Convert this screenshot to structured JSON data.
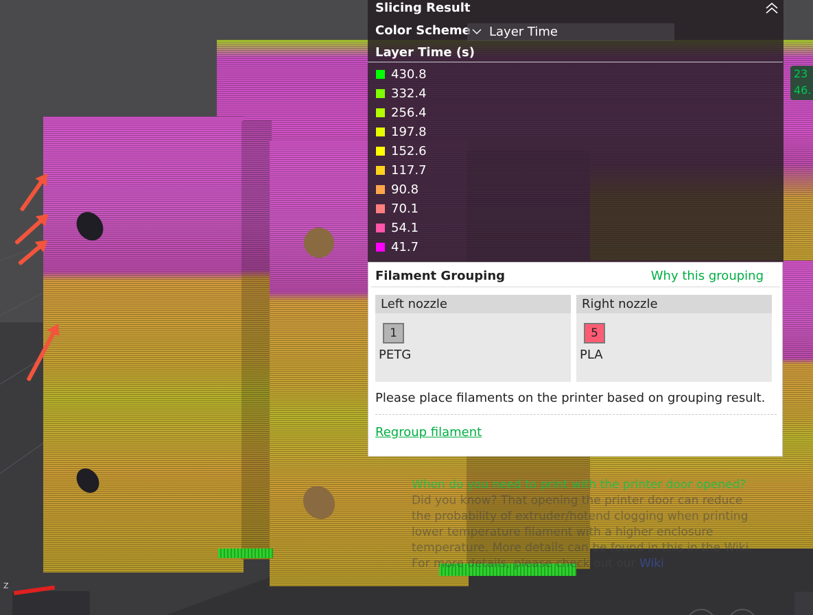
{
  "panel": {
    "title": "Slicing Result",
    "color_scheme_label": "Color Scheme",
    "color_scheme_value": "Layer Time",
    "legend_title": "Layer Time (s)",
    "legend": [
      {
        "value": "430.8",
        "color": "#00ff00"
      },
      {
        "value": "332.4",
        "color": "#7fff00"
      },
      {
        "value": "256.4",
        "color": "#b4ff00"
      },
      {
        "value": "197.8",
        "color": "#e6ff00"
      },
      {
        "value": "152.6",
        "color": "#ffff00"
      },
      {
        "value": "117.7",
        "color": "#ffd21e"
      },
      {
        "value": "90.8",
        "color": "#ffa64c"
      },
      {
        "value": "70.1",
        "color": "#ff7f7f"
      },
      {
        "value": "54.1",
        "color": "#ff55aa"
      },
      {
        "value": "41.7",
        "color": "#ff00ff"
      }
    ]
  },
  "grouping": {
    "title": "Filament Grouping",
    "why_link": "Why this grouping",
    "left": {
      "header": "Left nozzle",
      "slot": "1",
      "slot_color": "#b4b4b4",
      "material": "PETG"
    },
    "right": {
      "header": "Right nozzle",
      "slot": "5",
      "slot_color": "#ff5c74",
      "material": "PLA"
    },
    "note": "Please place filaments on the printer based on grouping result.",
    "regroup": "Regroup filament"
  },
  "tip": {
    "title": "When do you need to print with the printer door opened?",
    "lines": [
      "Did you know? That opening the printer door can reduce",
      "the probability of extruder/hotend clogging when printing",
      "lower temperature filament with a higher enclosure",
      "temperature. More details can be found in this in the Wiki."
    ],
    "last_line_prefix": "For more details, please check out our ",
    "last_line_link": "Wiki"
  },
  "overlay": {
    "badge_line1": "23",
    "badge_line2": "46.",
    "axis_z": "Z"
  },
  "accent": "#00ae42"
}
